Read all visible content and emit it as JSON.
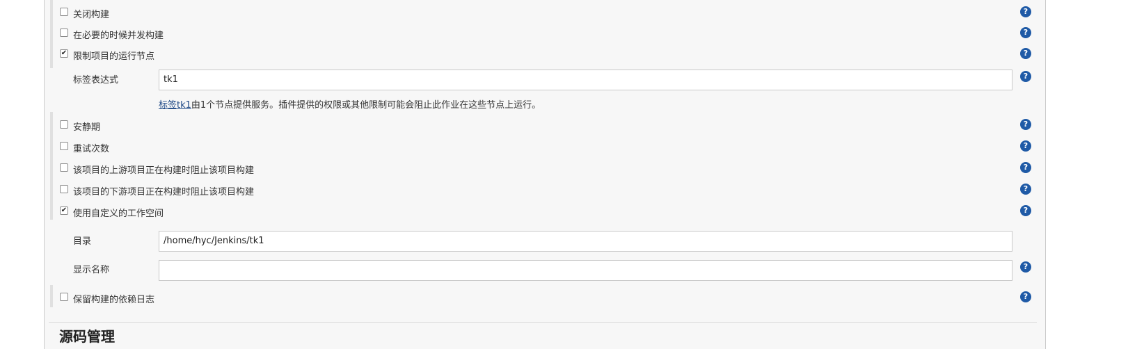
{
  "options_top": [
    {
      "label": "关闭构建",
      "checked": false
    },
    {
      "label": "在必要的时候并发构建",
      "checked": false
    },
    {
      "label": "限制项目的运行节点",
      "checked": true
    }
  ],
  "label_expression": {
    "label": "标签表达式",
    "value": "tk1",
    "info_link": "标签tk1",
    "info_text": "由1个节点提供服务。插件提供的权限或其他限制可能会阻止此作业在这些节点上运行。"
  },
  "options_middle": [
    {
      "label": "安静期",
      "checked": false
    },
    {
      "label": "重试次数",
      "checked": false
    },
    {
      "label": "该项目的上游项目正在构建时阻止该项目构建",
      "checked": false
    },
    {
      "label": "该项目的下游项目正在构建时阻止该项目构建",
      "checked": false
    },
    {
      "label": "使用自定义的工作空间",
      "checked": true
    }
  ],
  "workspace": {
    "directory_label": "目录",
    "directory_value": "/home/hyc/Jenkins/tk1",
    "display_name_label": "显示名称",
    "display_name_value": ""
  },
  "options_bottom": [
    {
      "label": "保留构建的依赖日志",
      "checked": false
    }
  ],
  "section_title": "源码管理",
  "help_glyph": "?",
  "check_glyph": "✔",
  "colors": {
    "help_icon": "#1f5aa6",
    "link": "#204a87"
  }
}
